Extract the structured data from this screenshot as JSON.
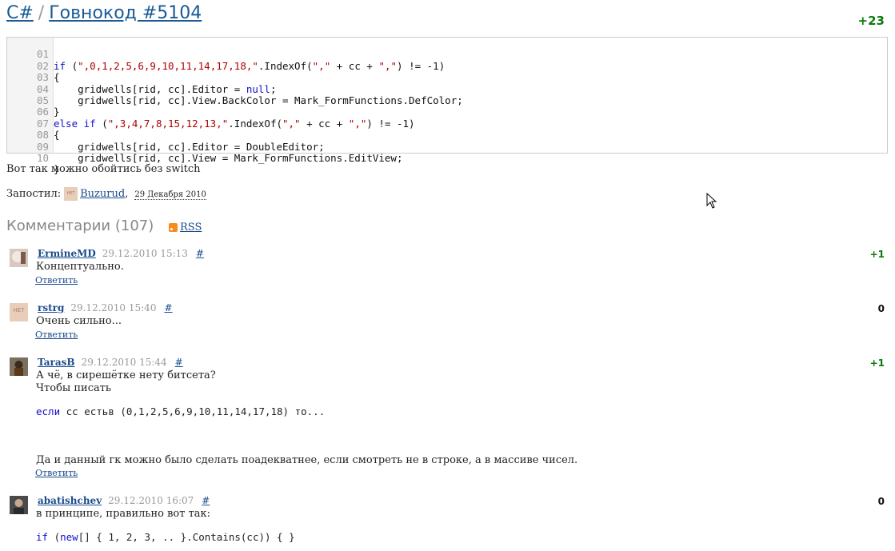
{
  "header": {
    "lang": "C#",
    "separator": "/",
    "title": "Говнокод #5104",
    "score": "+23"
  },
  "code": {
    "lines": [
      {
        "num": "01"
      },
      {
        "num": "02"
      },
      {
        "num": "03"
      },
      {
        "num": "04"
      },
      {
        "num": "05"
      },
      {
        "num": "06"
      },
      {
        "num": "07"
      },
      {
        "num": "08"
      },
      {
        "num": "09"
      },
      {
        "num": "10"
      }
    ],
    "text": [
      "if (\",0,1,2,5,6,9,10,11,14,17,18,\".IndexOf(\",\" + cc + \",\") != -1)",
      "{",
      "    gridwells[rid, cc].Editor = null;",
      "    gridwells[rid, cc].View.BackColor = Mark_FormFunctions.DefColor;",
      "}",
      "else if (\",3,4,7,8,15,12,13,\".IndexOf(\",\" + cc + \",\") != -1)",
      "{",
      "    gridwells[rid, cc].Editor = DoubleEditor;",
      "    gridwells[rid, cc].View = Mark_FormFunctions.EditView;",
      "}"
    ]
  },
  "description": "Вот так можно обойтись без switch",
  "posted": {
    "label": "Запостил:",
    "author": "Buzurud",
    "comma": ",",
    "date": "29 Декабря 2010",
    "avatar_text": "НЕТ"
  },
  "comments_header": {
    "title": "Комментарии (107)",
    "rss": "RSS"
  },
  "comments": [
    {
      "nick": "ErmineMD",
      "time": "29.12.2010 15:13",
      "hash": "#",
      "score": "+1",
      "body": [
        "Концептуально."
      ],
      "reply": "Ответить"
    },
    {
      "nick": "rstrg",
      "time": "29.12.2010 15:40",
      "hash": "#",
      "score": "0",
      "body": [
        "Очень сильно..."
      ],
      "reply": "Ответить",
      "avatar_text": "НЕТ"
    },
    {
      "nick": "TarasB",
      "time": "29.12.2010 15:44",
      "hash": "#",
      "score": "+1",
      "body": [
        "А чё, в сирешётке нету битсета?",
        "Чтобы писать"
      ],
      "code_kw": "если",
      "code_rest": " cc естьв (0,1,2,5,6,9,10,11,14,17,18) то...",
      "body_after": "Да и данный гк можно было сделать поадекватнее, если смотреть не в строке, а в массиве чисел.",
      "reply": "Ответить"
    },
    {
      "nick": "abatishchev",
      "time": "29.12.2010 16:07",
      "hash": "#",
      "score": "0",
      "body": [
        "в принципе, правильно вот так:"
      ],
      "code_kw1": "if",
      "code_mid": " (",
      "code_kw2": "new",
      "code_rest": "[] { 1, 2, 3, .. }.Contains(cc)) { }"
    }
  ]
}
